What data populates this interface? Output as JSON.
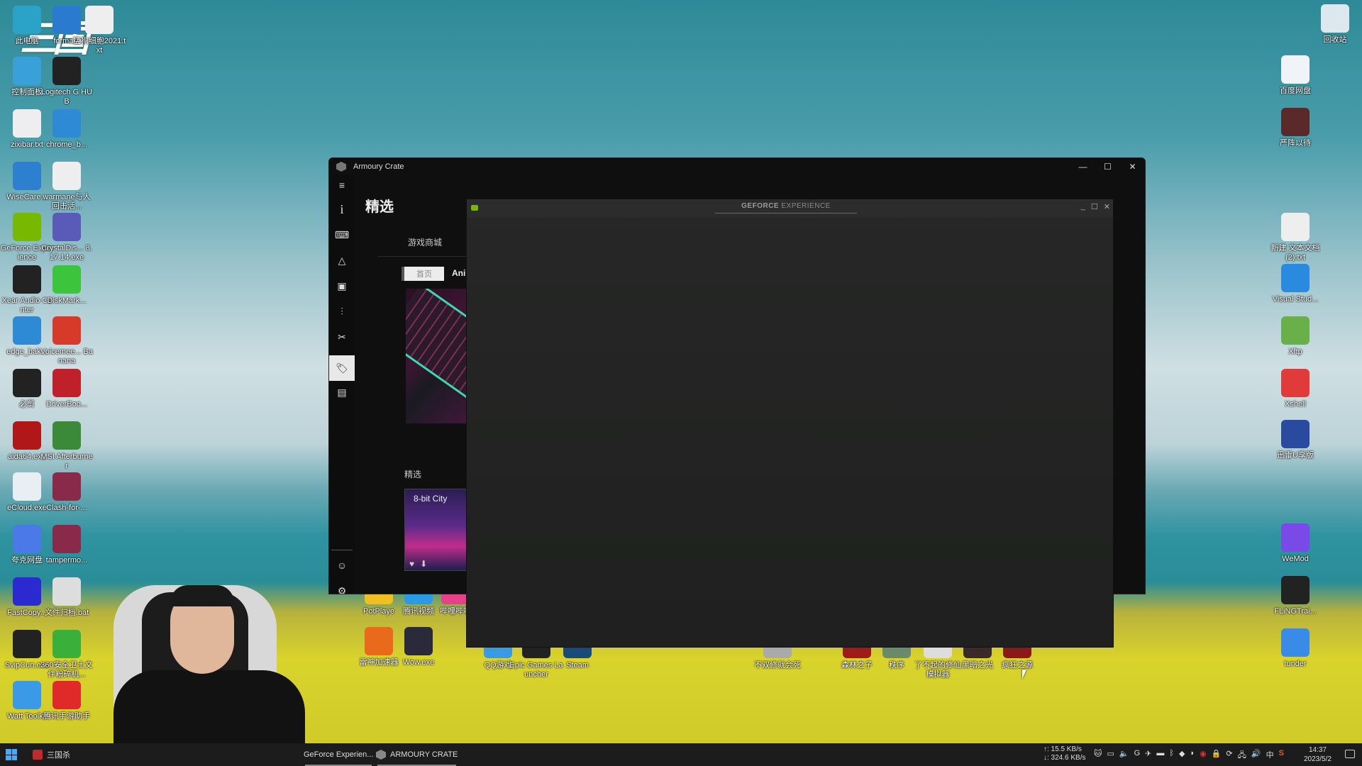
{
  "desktop": {
    "overlay_logo": "三国",
    "left_icons": [
      {
        "label": "此电脑",
        "icon": "computer-icon",
        "color": "#2aa3c6"
      },
      {
        "label": "forma...",
        "icon": "shortcut-icon",
        "color": "#2a7ad0"
      },
      {
        "label": "猛狗细胞2021.txt",
        "icon": "text-file-icon",
        "color": "#eeeeee"
      },
      {
        "label": "控制面板",
        "icon": "control-panel-icon",
        "color": "#3aa0d8"
      },
      {
        "label": "Logitech G HUB",
        "icon": "logitech-icon",
        "color": "#222222"
      },
      {
        "label": "zixibar.txt",
        "icon": "text-file-icon",
        "color": "#eeeeee"
      },
      {
        "label": "chrome_b...",
        "icon": "edge-icon",
        "color": "#2f8ad6"
      },
      {
        "label": "WiseCare...",
        "icon": "wisecare-icon",
        "color": "#2d7fd0"
      },
      {
        "label": "warmane与人回击活...",
        "icon": "text-file-icon",
        "color": "#eeeeee"
      },
      {
        "label": "GeForce Experience",
        "icon": "nvidia-icon",
        "color": "#76b900"
      },
      {
        "label": "CrystalDis... 8.17.14.exe",
        "icon": "crystaldisk-icon",
        "color": "#5a5ab8"
      },
      {
        "label": "Xear Audio Center",
        "icon": "xear-icon",
        "color": "#222222"
      },
      {
        "label": "DiskMark...",
        "icon": "diskmark-icon",
        "color": "#3cc43c"
      },
      {
        "label": "edge_bak...",
        "icon": "edge-icon",
        "color": "#2f8ad6"
      },
      {
        "label": "Voicemee... Banana",
        "icon": "voicemeeter-icon",
        "color": "#d83a2a"
      },
      {
        "label": "必剪",
        "icon": "bijian-icon",
        "color": "#222222"
      },
      {
        "label": "DriverBoo...",
        "icon": "driverbooster-icon",
        "color": "#c0202a"
      },
      {
        "label": "aida64.exe",
        "icon": "aida64-icon",
        "color": "#b01818"
      },
      {
        "label": "MSI Afterburner",
        "icon": "afterburner-icon",
        "color": "#3a8a3a"
      },
      {
        "label": "eCloud.exe",
        "icon": "ecloud-icon",
        "color": "#e8eef2"
      },
      {
        "label": "Clash-for-...",
        "icon": "winrar-icon",
        "color": "#8a2a4a"
      },
      {
        "label": "夸克网盘",
        "icon": "quark-icon",
        "color": "#4a7ae8"
      },
      {
        "label": "tampermo...",
        "icon": "winrar-icon",
        "color": "#8a2a4a"
      },
      {
        "label": "FastCopy...",
        "icon": "fastcopy-icon",
        "color": "#2a2ad0"
      },
      {
        "label": "文件归档.bat",
        "icon": "bat-file-icon",
        "color": "#dddddd"
      },
      {
        "label": "SvipCun.exe",
        "icon": "deer-icon",
        "color": "#222222"
      },
      {
        "label": "360安全卫士文件粉碎机...",
        "icon": "360-icon",
        "color": "#3ab03a"
      },
      {
        "label": "Watt Toolkit",
        "icon": "watt-toolkit-icon",
        "color": "#3a9ae8"
      },
      {
        "label": "腾讯手游助手",
        "icon": "tencent-game-icon",
        "color": "#e02a2a"
      }
    ],
    "right_icons": [
      {
        "label": "回收站",
        "icon": "recycle-bin-icon",
        "color": "#dde8ee"
      },
      {
        "label": "百度网盘",
        "icon": "baidu-netdisk-icon",
        "color": "#f0f4f8"
      },
      {
        "label": "严阵以待",
        "icon": "ready-or-not-icon",
        "color": "#5a2a2a"
      },
      {
        "label": "新建 文本文档 (2).txt",
        "icon": "text-file-icon",
        "color": "#eeeeee"
      },
      {
        "label": "Visual Stud...",
        "icon": "vscode-icon",
        "color": "#2a8ae0"
      },
      {
        "label": "Xftp",
        "icon": "xftp-icon",
        "color": "#6ab04a"
      },
      {
        "label": "Xshell",
        "icon": "xshell-icon",
        "color": "#e03a3a"
      },
      {
        "label": "迅雷U享版",
        "icon": "thunder-icon",
        "color": "#2a4aa0"
      },
      {
        "label": "WeMod",
        "icon": "wemod-icon",
        "color": "#7a4ae8"
      },
      {
        "label": "FLiNGTrai...",
        "icon": "fling-icon",
        "color": "#222222"
      },
      {
        "label": "tunder",
        "icon": "thunder-icon",
        "color": "#3a8ae8"
      }
    ],
    "bottom_icons": [
      {
        "label": "PotPlaye",
        "icon": "potplayer-icon",
        "color": "#f0c020"
      },
      {
        "label": "腾讯视频",
        "icon": "tencent-video-icon",
        "color": "#2a9ae8"
      },
      {
        "label": "哔哩哔哩",
        "icon": "bilibili-icon",
        "color": "#e8408a"
      },
      {
        "label": "雷神加速器",
        "icon": "leishen-icon",
        "color": "#e86a1a"
      },
      {
        "label": "Wow.exe",
        "icon": "wow-icon",
        "color": "#2a2a3a"
      },
      {
        "label": "QQ游戏",
        "icon": "qqgame-icon",
        "color": "#3a9ae8"
      },
      {
        "label": "Epic Games Launcher",
        "icon": "epic-icon",
        "color": "#222222"
      },
      {
        "label": "Steam",
        "icon": "steam-icon",
        "color": "#1a4a7a"
      },
      {
        "label": "不双修就会死",
        "icon": "game-icon",
        "color": "#aaaaaa"
      },
      {
        "label": "森林之子",
        "icon": "game-icon",
        "color": "#a01a1a"
      },
      {
        "label": "秩序",
        "icon": "game-icon",
        "color": "#6a8a6a"
      },
      {
        "label": "了不起的修仙模拟器",
        "icon": "game-icon",
        "color": "#dddddd"
      },
      {
        "label": "黑暗之光",
        "icon": "game-icon",
        "color": "#3a2a2a"
      },
      {
        "label": "疯狂之源",
        "icon": "game-icon",
        "color": "#8a1a1a"
      }
    ]
  },
  "armoury_crate": {
    "title": "Armoury Crate",
    "page_title": "精选",
    "tab": "游戏商城",
    "home_button": "首页",
    "next_tab_partial": "Anil",
    "section_title": "精选",
    "card": {
      "title": "8-bit City"
    },
    "sidebar": [
      {
        "name": "menu-icon",
        "glyph": "≡"
      },
      {
        "name": "info-icon",
        "glyph": "i"
      },
      {
        "name": "device-icon",
        "glyph": "⌨"
      },
      {
        "name": "aura-icon",
        "glyph": "△"
      },
      {
        "name": "game-library-icon",
        "glyph": "▣"
      },
      {
        "name": "scenario-icon",
        "glyph": "⫶"
      },
      {
        "name": "tools-icon",
        "glyph": "✂"
      },
      {
        "name": "deals-icon",
        "glyph": "🏷"
      },
      {
        "name": "news-icon",
        "glyph": "▤"
      }
    ],
    "sidebar_bottom": [
      {
        "name": "user-icon",
        "glyph": "☺"
      },
      {
        "name": "settings-icon",
        "glyph": "⚙"
      }
    ],
    "controls": {
      "minimize": "—",
      "maximize": "☐",
      "close": "✕"
    }
  },
  "geforce_experience": {
    "title_bold": "GEFORCE",
    "title_rest": " EXPERIENCE",
    "controls": {
      "minimize": "_",
      "maximize": "☐",
      "close": "✕"
    }
  },
  "taskbar": {
    "items": [
      {
        "label": "三国杀",
        "color": "#c02a2a"
      },
      {
        "label": "GeForce Experien...",
        "color": "#76b900"
      },
      {
        "label": "ARMOURY CRATE",
        "color": "#888888"
      }
    ],
    "network_up": "↑: 15.5 KB/s",
    "network_down": "↓: 324.6 KB/s",
    "ime": "中",
    "time": "14:37",
    "date": "2023/5/2"
  }
}
